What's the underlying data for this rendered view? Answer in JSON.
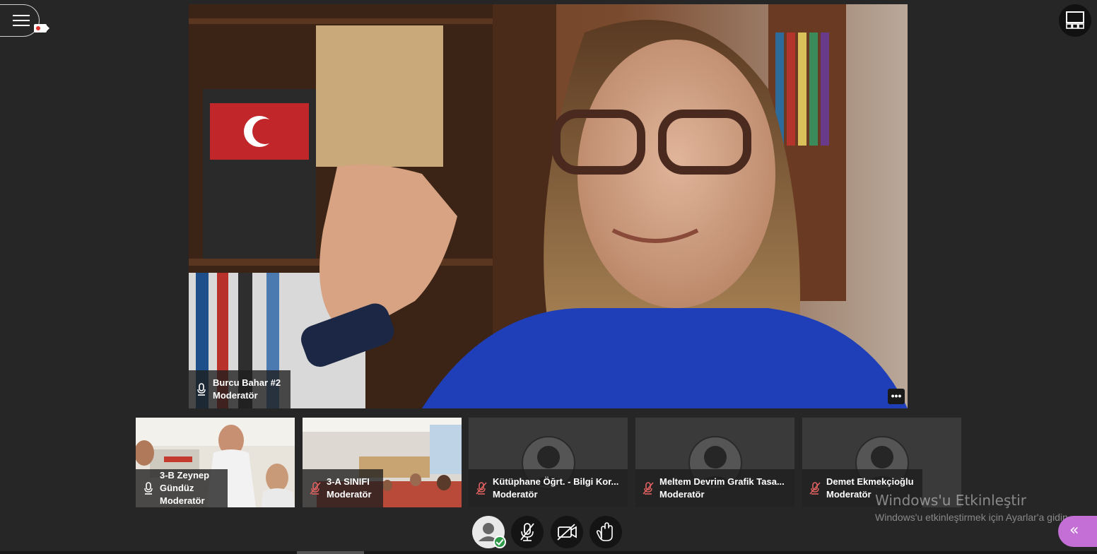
{
  "colors": {
    "background": "#262626",
    "tile_bg": "#3a3a3a",
    "status_ok": "#2e9b48",
    "collapse_accent": "#c46fd6",
    "muted_icon": "#e06060"
  },
  "toolbar": {
    "menu_icon": "hamburger-icon",
    "recording_icon": "recording-camera-icon",
    "layout_icon": "layout-grid-icon"
  },
  "main_video": {
    "name": "Burcu Bahar #2",
    "role": "Moderatör",
    "mic_icon": "microphone-icon",
    "more_label": "•••"
  },
  "participants": [
    {
      "name": "3-B Zeynep Gündüz",
      "role": "Moderatör",
      "mic": "microphone-icon",
      "has_video": true
    },
    {
      "name": "3-A SINIFI",
      "role": "Moderatör",
      "mic": "microphone-muted-icon",
      "has_video": true
    },
    {
      "name": "Kütüphane Öğrt. - Bilgi Kor...",
      "role": "Moderatör",
      "mic": "microphone-muted-icon",
      "has_video": false
    },
    {
      "name": "Meltem Devrim Grafik Tasa...",
      "role": "Moderatör",
      "mic": "microphone-muted-icon",
      "has_video": false
    },
    {
      "name": "Demet Ekmekçioğlu",
      "role": "Moderatör",
      "mic": "microphone-muted-icon",
      "has_video": false
    }
  ],
  "controls": [
    {
      "name": "status-control",
      "icon": "user-avatar-icon",
      "status": "available"
    },
    {
      "name": "microphone-toggle",
      "icon": "microphone-muted-icon"
    },
    {
      "name": "camera-toggle",
      "icon": "camera-off-icon"
    },
    {
      "name": "raise-hand",
      "icon": "hand-icon"
    }
  ],
  "watermark": {
    "title": "Windows'u Etkinleştir",
    "subtitle": "Windows'u etkinleştirmek için Ayarlar'a gidin."
  },
  "collapse": {
    "label": "«",
    "icon": "double-chevron-left-icon"
  }
}
